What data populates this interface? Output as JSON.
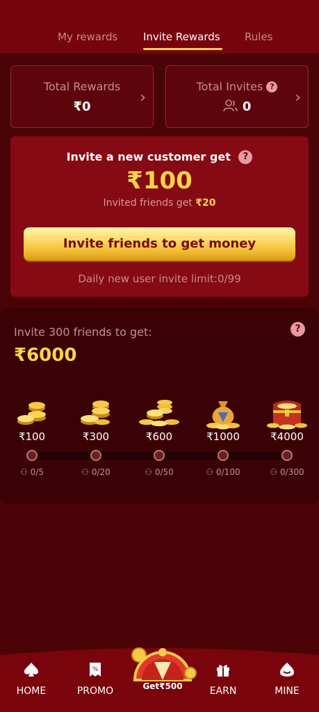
{
  "tabs": [
    {
      "label": "My rewards"
    },
    {
      "label": "Invite Rewards"
    },
    {
      "label": "Rules"
    }
  ],
  "stats": {
    "total_rewards_label": "Total Rewards",
    "total_rewards_value": "₹0",
    "total_invites_label": "Total Invites",
    "total_invites_value": "0"
  },
  "invite": {
    "headline": "Invite a new customer get",
    "amount": "₹100",
    "friends_text": "Invited friends get",
    "friends_amount": "₹20",
    "button_label": "Invite friends to get money",
    "limit_text": "Daily new user invite limit:0/99"
  },
  "milestones_section": {
    "title": "Invite 300 friends to get:",
    "amount": "₹6000",
    "items": [
      {
        "reward": "₹100",
        "count": "0/5"
      },
      {
        "reward": "₹300",
        "count": "0/20"
      },
      {
        "reward": "₹600",
        "count": "0/50"
      },
      {
        "reward": "₹1000",
        "count": "0/100"
      },
      {
        "reward": "₹4000",
        "count": "0/300"
      }
    ]
  },
  "nav": {
    "home": "HOME",
    "promo": "PROMO",
    "center": "Get₹500",
    "earn": "EARN",
    "mine": "MINE"
  },
  "colors": {
    "accent_gold": "#ffd34a",
    "background": "#4a0307",
    "header": "#76040c",
    "card": "#860a13"
  },
  "icons": [
    "chevron-right-icon",
    "question-icon",
    "users-icon",
    "coin-stack-icon",
    "money-bag-icon",
    "treasure-chest-icon",
    "spade-icon",
    "promo-icon",
    "gift-icon",
    "mine-icon",
    "wheel-icon"
  ]
}
